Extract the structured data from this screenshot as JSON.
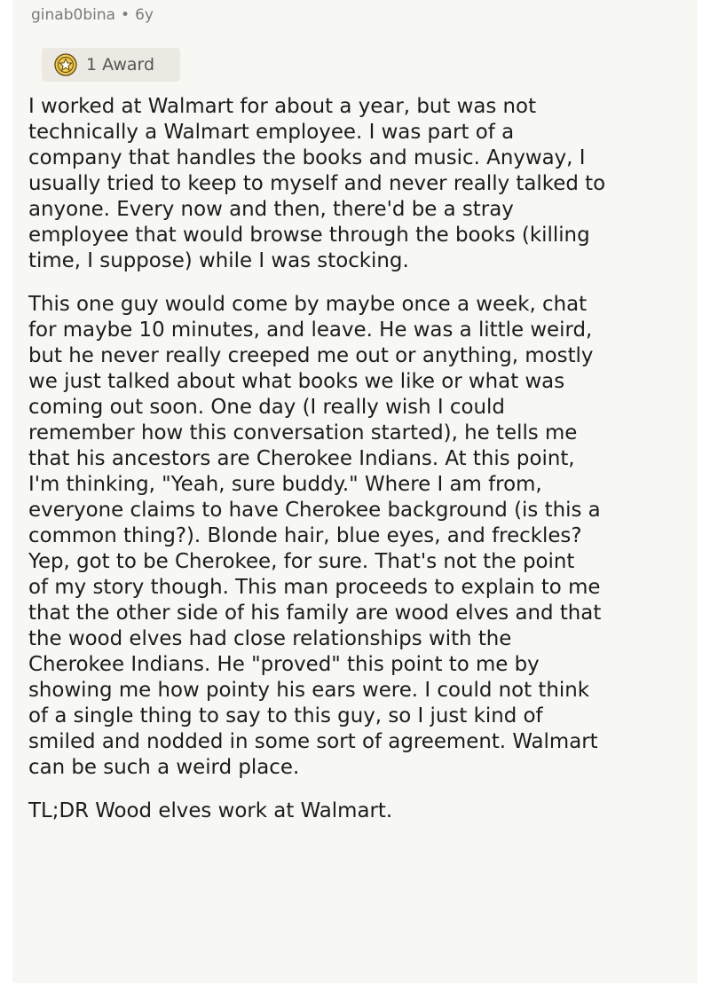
{
  "post": {
    "username": "ginab0bina",
    "separator": "•",
    "age": "6y",
    "award": {
      "icon": "award-icon",
      "label": "1 Award"
    },
    "paragraphs": [
      [
        "I worked at Walmart for about a year, but was not",
        "technically a Walmart employee. I was part of a",
        "company that handles the books and music. Anyway, I",
        "usually tried to keep to myself and never really talked to",
        "anyone. Every now and then, there'd be a stray",
        "employee that would browse through the books (killing",
        "time, I suppose) while I was stocking."
      ],
      [
        "This one guy would come by maybe once a week, chat",
        "for maybe 10 minutes, and leave. He was a little weird,",
        "but he never really creeped me out or anything, mostly",
        "we just talked about what books we like or what was",
        "coming out soon. One day (I really wish I could",
        "remember how this conversation started), he tells me",
        "that his ancestors are Cherokee Indians. At this point,",
        "I'm thinking, \"Yeah, sure buddy.\" Where I am from,",
        "everyone claims to have Cherokee background (is this a",
        "common thing?). Blonde hair, blue eyes, and freckles?",
        "Yep, got to be Cherokee, for sure. That's not the point",
        "of my story though. This man proceeds to explain to me",
        "that the other side of his family are wood elves and that",
        "the wood elves had close relationships with the",
        "Cherokee Indians. He \"proved\" this point to me by",
        "showing me how pointy his ears were. I could not think",
        "of a single thing to say to this guy, so I just kind of",
        "smiled and nodded in some sort of agreement. Walmart",
        "can be such a weird place."
      ],
      [
        "TL;DR Wood elves work at Walmart."
      ]
    ]
  }
}
